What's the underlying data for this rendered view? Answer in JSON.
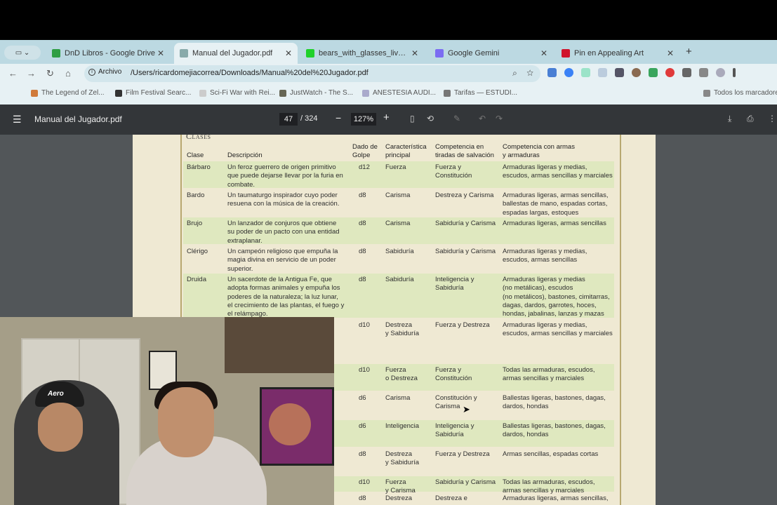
{
  "browser": {
    "sidebar_icon": "sidebar-icon",
    "tabs": [
      {
        "title": "DnD Libros - Google Drive",
        "icon": "google-drive-icon",
        "color": "#2f9e44"
      },
      {
        "title": "Manual del Jugador.pdf",
        "icon": "globe-icon",
        "color": "#8aa"
      },
      {
        "title": "bears_with_glasses_live Stre",
        "icon": "kick-icon",
        "color": "#1fd12a"
      },
      {
        "title": "Google Gemini",
        "icon": "gemini-icon",
        "color": "#7b6cf2"
      },
      {
        "title": "Pin en Appealing Art",
        "icon": "pinterest-icon",
        "color": "#d0142c"
      }
    ],
    "omnibox": {
      "chip": "Archivo",
      "url": "/Users/ricardomejiacorrea/Downloads/Manual%20del%20Jugador.pdf"
    },
    "bookmarks": [
      {
        "label": "The Legend of Zel...",
        "color": "#d07a3a"
      },
      {
        "label": "Film Festival Searc...",
        "color": "#333"
      },
      {
        "label": "Sci-Fi War with Rei...",
        "color": "#ccc"
      },
      {
        "label": "JustWatch - The S...",
        "color": "#665"
      },
      {
        "label": "ANESTESIA AUDI...",
        "color": "#aac"
      },
      {
        "label": "Tarifas — ESTUDI...",
        "color": "#777"
      },
      {
        "label": "Todos los marcadores",
        "color": "#888"
      }
    ]
  },
  "pdf": {
    "doc_name": "Manual del Jugador.pdf",
    "page": "47",
    "total": "/ 324",
    "zoom": "127%",
    "section_heading": "Clases",
    "headers": {
      "clase": "Clase",
      "descripcion": "Descripción",
      "dado": [
        "Dado de",
        "Golpe"
      ],
      "caracteristica": [
        "Característica",
        "principal"
      ],
      "competencia_salvacion": [
        "Competencia en",
        "tiradas de salvación"
      ],
      "competencia_armas": [
        "Competencia con armas",
        "y armaduras"
      ]
    },
    "rows": [
      {
        "clase": "Bárbaro",
        "descripcion": [
          "Un feroz guerrero de origen primitivo",
          "que puede dejarse llevar por la furia en",
          "combate."
        ],
        "dado": "d12",
        "caracteristica": [
          "Fuerza"
        ],
        "salvacion": [
          "Fuerza y",
          "Constitución"
        ],
        "armas": [
          "Armaduras ligeras y medias,",
          "escudos, armas sencillas y marciales"
        ]
      },
      {
        "clase": "Bardo",
        "descripcion": [
          "Un taumaturgo inspirador cuyo poder",
          "resuena con la música de la creación."
        ],
        "dado": "d8",
        "caracteristica": [
          "Carisma"
        ],
        "salvacion": [
          "Destreza y Carisma"
        ],
        "armas": [
          "Armaduras ligeras, armas sencillas,",
          "ballestas de mano, espadas cortas,",
          "espadas largas, estoques"
        ]
      },
      {
        "clase": "Brujo",
        "descripcion": [
          "Un lanzador de conjuros que obtiene",
          "su poder de un pacto con una entidad",
          "extraplanar."
        ],
        "dado": "d8",
        "caracteristica": [
          "Carisma"
        ],
        "salvacion": [
          "Sabiduría y Carisma"
        ],
        "armas": [
          "Armaduras ligeras, armas sencillas"
        ]
      },
      {
        "clase": "Clérigo",
        "descripcion": [
          "Un campeón religioso que empuña la",
          "magia divina en servicio de un poder",
          "superior."
        ],
        "dado": "d8",
        "caracteristica": [
          "Sabiduría"
        ],
        "salvacion": [
          "Sabiduría y Carisma"
        ],
        "armas": [
          "Armaduras ligeras y medias,",
          "escudos, armas sencillas"
        ]
      },
      {
        "clase": "Druida",
        "descripcion": [
          "Un sacerdote de la Antigua Fe, que",
          "adopta formas animales y empuña los",
          "poderes de la naturaleza; la luz lunar,",
          "el crecimiento de las plantas, el fuego y",
          "el relámpago."
        ],
        "dado": "d8",
        "caracteristica": [
          "Sabiduría"
        ],
        "salvacion": [
          "Inteligencia y",
          "Sabiduría"
        ],
        "armas": [
          "Armaduras ligeras y medias",
          "(no metálicas), escudos",
          "(no metálicos), bastones, cimitarras,",
          "dagas, dardos, garrotes, hoces,",
          "hondas, jabalinas, lanzas y mazas"
        ]
      },
      {
        "clase": "",
        "descripcion": [],
        "dado": "d10",
        "caracteristica": [
          "Destreza",
          "y Sabiduría"
        ],
        "salvacion": [
          "Fuerza y Destreza"
        ],
        "armas": [
          "Armaduras ligeras y medias,",
          "escudos, armas sencillas y marciales"
        ]
      },
      {
        "clase": "",
        "descripcion": [],
        "dado": "d10",
        "caracteristica": [
          "Fuerza",
          "o Destreza"
        ],
        "salvacion": [
          "Fuerza y",
          "Constitución"
        ],
        "armas": [
          "Todas las armaduras, escudos,",
          "armas sencillas y marciales"
        ]
      },
      {
        "clase": "",
        "descripcion": [],
        "dado": "d6",
        "caracteristica": [
          "Carisma"
        ],
        "salvacion": [
          "Constitución y",
          "Carisma"
        ],
        "armas": [
          "Ballestas ligeras, bastones, dagas,",
          "dardos, hondas"
        ]
      },
      {
        "clase": "",
        "descripcion": [],
        "dado": "d6",
        "caracteristica": [
          "Inteligencia"
        ],
        "salvacion": [
          "Inteligencia y",
          "Sabiduría"
        ],
        "armas": [
          "Ballestas ligeras, bastones, dagas,",
          "dardos, hondas"
        ]
      },
      {
        "clase": "",
        "descripcion": [],
        "dado": "d8",
        "caracteristica": [
          "Destreza",
          "y Sabiduría"
        ],
        "salvacion": [
          "Fuerza y Destreza"
        ],
        "armas": [
          "Armas sencillas, espadas cortas"
        ]
      },
      {
        "clase": "",
        "descripcion": [],
        "dado": "d10",
        "caracteristica": [
          "Fuerza",
          "y Carisma"
        ],
        "salvacion": [
          "Sabiduría y Carisma"
        ],
        "armas": [
          "Todas las armaduras, escudos,",
          "armas sencillas y marciales"
        ]
      },
      {
        "clase": "",
        "descripcion": [],
        "dado": "d8",
        "caracteristica": [
          "Destreza"
        ],
        "salvacion": [
          "Destreza e"
        ],
        "armas": [
          "Armaduras ligeras, armas sencillas,"
        ]
      }
    ]
  },
  "webcam": {
    "cap_text": "Aero"
  }
}
